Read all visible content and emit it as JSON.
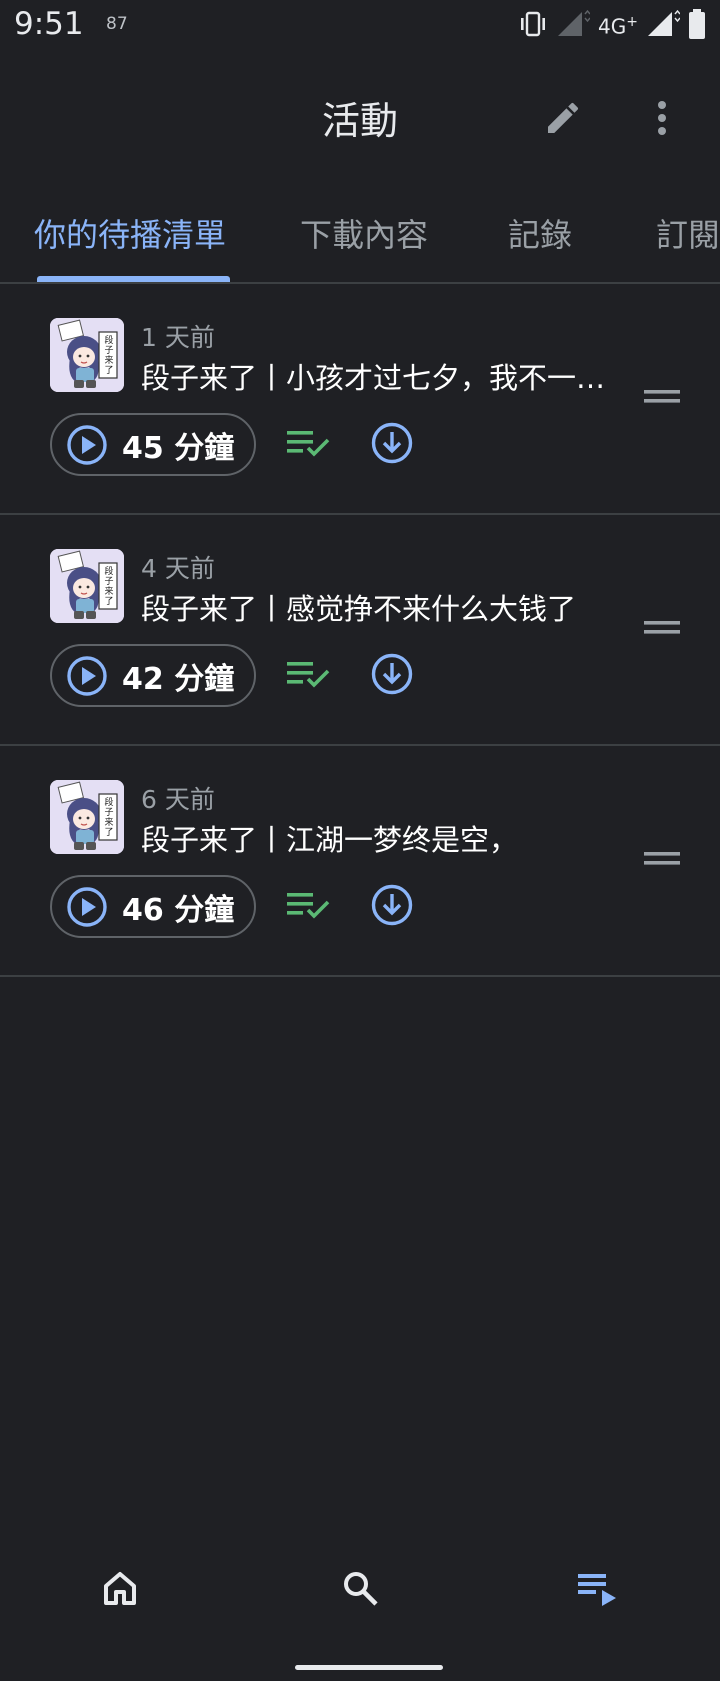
{
  "status_bar": {
    "time": "9:51",
    "battery_level": "87",
    "network_type": "4G",
    "network_plus": "+"
  },
  "app_bar": {
    "title": "活動",
    "edit_icon": "pencil-icon",
    "more_icon": "more-vert-icon"
  },
  "tabs": [
    {
      "label": "你的待播清單",
      "active": true
    },
    {
      "label": "下載內容",
      "active": false
    },
    {
      "label": "記錄",
      "active": false
    },
    {
      "label": "訂閱",
      "active": false
    }
  ],
  "queue": [
    {
      "age": "1 天前",
      "title": "段子来了丨小孩才过七夕，我不一样，我想要钱",
      "duration": "45 分鐘",
      "queued": true
    },
    {
      "age": "4 天前",
      "title": "段子来了丨感觉挣不来什么大钱了",
      "duration": "42 分鐘",
      "queued": true
    },
    {
      "age": "6 天前",
      "title": "段子来了丨江湖一梦终是空，",
      "duration": "46 分鐘",
      "queued": true
    }
  ],
  "thumbnail": {
    "sign_text": "段子来了",
    "alt": "podcast-cover"
  },
  "bottom_nav": [
    {
      "name": "home",
      "icon": "home-icon",
      "active": false
    },
    {
      "name": "search",
      "icon": "search-icon",
      "active": false
    },
    {
      "name": "activity",
      "icon": "playlist-play-icon",
      "active": true
    }
  ],
  "colors": {
    "background": "#1f2024",
    "accent": "#8ab4f8",
    "queued_green": "#5bb974",
    "divider": "#3c4043"
  }
}
